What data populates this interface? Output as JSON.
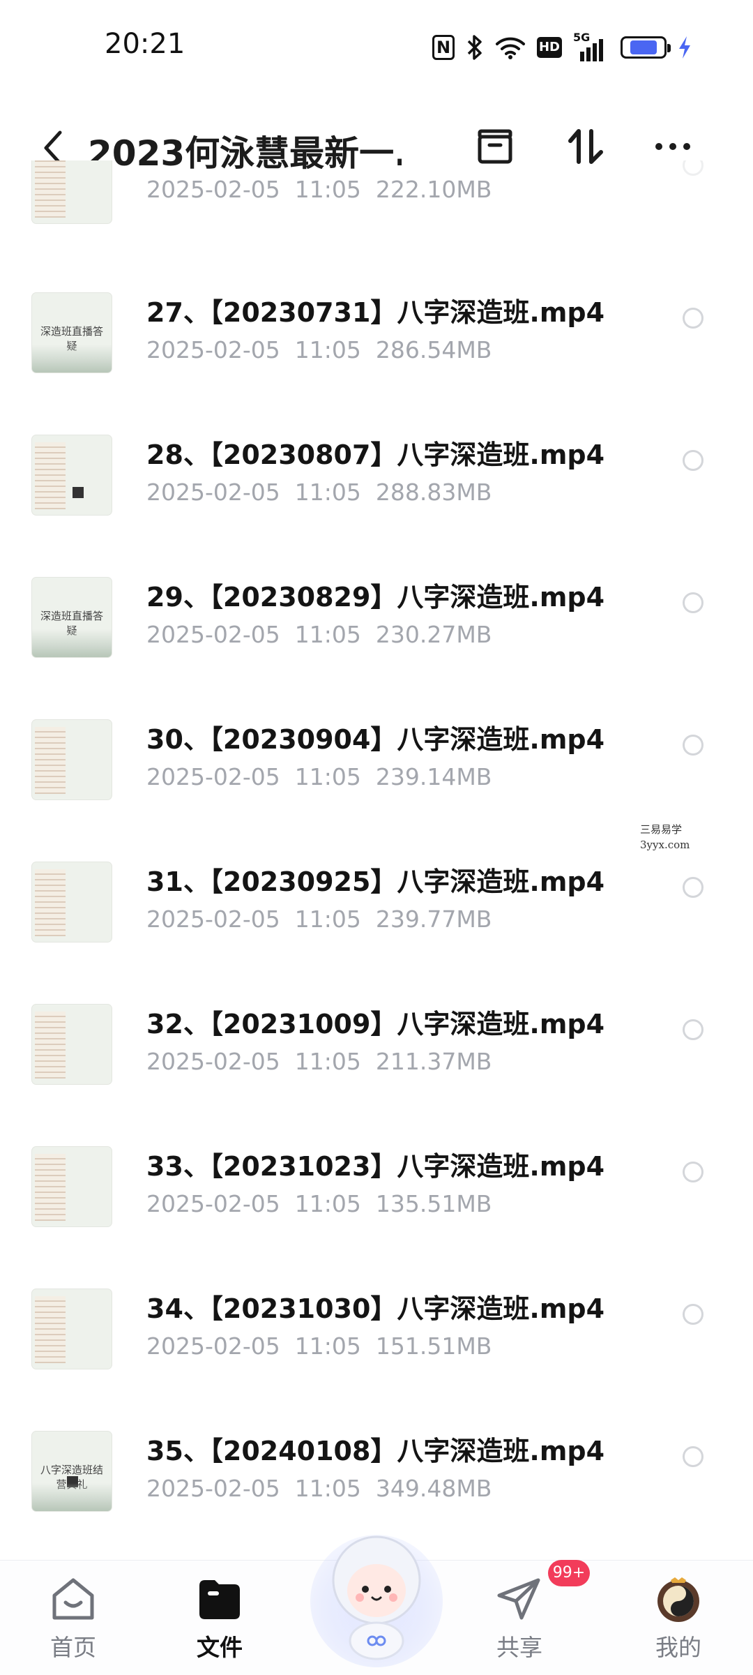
{
  "status_bar": {
    "time": "20:21",
    "icons": [
      "nfc-icon",
      "bluetooth-icon",
      "wifi-icon",
      "hd-icon",
      "5g-signal-icon",
      "battery-icon",
      "charging-icon"
    ],
    "hd_label": "HD",
    "network_label": "5G",
    "nfc_label": "N",
    "battery_level": 0.72
  },
  "header": {
    "title": "2023何泳慧最新一...",
    "buttons": [
      "back-icon",
      "archive-icon",
      "sort-icon",
      "more-icon"
    ]
  },
  "files": [
    {
      "name": "",
      "date": "2025-02-05",
      "time": "11:05",
      "size": "222.10MB"
    },
    {
      "name": "27、【20230731】八字深造班.mp4",
      "date": "2025-02-05",
      "time": "11:05",
      "size": "286.54MB"
    },
    {
      "name": "28、【20230807】八字深造班.mp4",
      "date": "2025-02-05",
      "time": "11:05",
      "size": "288.83MB"
    },
    {
      "name": "29、【20230829】八字深造班.mp4",
      "date": "2025-02-05",
      "time": "11:05",
      "size": "230.27MB"
    },
    {
      "name": "30、【20230904】八字深造班.mp4",
      "date": "2025-02-05",
      "time": "11:05",
      "size": "239.14MB"
    },
    {
      "name": "31、【20230925】八字深造班.mp4",
      "date": "2025-02-05",
      "time": "11:05",
      "size": "239.77MB"
    },
    {
      "name": "32、【20231009】八字深造班.mp4",
      "date": "2025-02-05",
      "time": "11:05",
      "size": "211.37MB"
    },
    {
      "name": "33、【20231023】八字深造班.mp4",
      "date": "2025-02-05",
      "time": "11:05",
      "size": "135.51MB"
    },
    {
      "name": "34、【20231030】八字深造班.mp4",
      "date": "2025-02-05",
      "time": "11:05",
      "size": "151.51MB"
    },
    {
      "name": "35、【20240108】八字深造班.mp4",
      "date": "2025-02-05",
      "time": "11:05",
      "size": "349.48MB"
    }
  ],
  "thumb_texts": {
    "banner": "深造班直播答疑",
    "ceremony": "八字深造班结营典礼"
  },
  "watermark": {
    "line1": "三易易学",
    "line2": "3yyx.com"
  },
  "bottom_nav": {
    "home": "首页",
    "files": "文件",
    "share": "共享",
    "mine": "我的",
    "share_badge": "99+"
  },
  "colors": {
    "accent": "#4a66f2",
    "badge": "#f23c5a",
    "meta_text": "#a3a6ad"
  }
}
